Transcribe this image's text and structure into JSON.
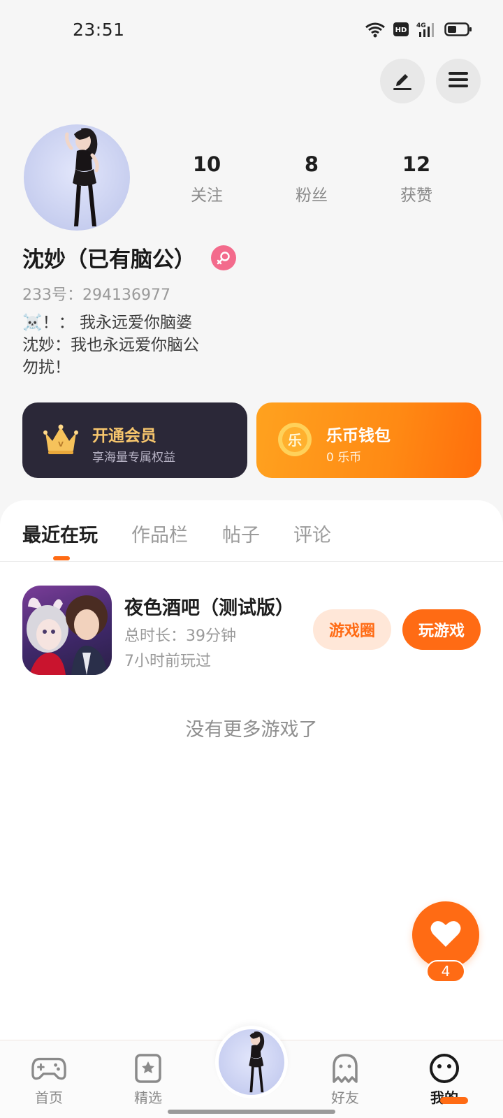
{
  "status_bar": {
    "time": "23:51",
    "network": "4G",
    "hd_label": "HD"
  },
  "profile": {
    "nickname": "沈妙（已有脑公）",
    "uid": "233号：294136977",
    "bio_lines": [
      "☠️！： 我永远爱你脑婆",
      "沈妙：我也永远爱你脑公",
      "勿扰！"
    ],
    "stats": [
      {
        "num": "10",
        "label": "关注"
      },
      {
        "num": "8",
        "label": "粉丝"
      },
      {
        "num": "12",
        "label": "获赞"
      }
    ]
  },
  "cards": {
    "vip": {
      "title": "开通会员",
      "subtitle": "享海量专属权益"
    },
    "wallet": {
      "title": "乐币钱包",
      "subtitle": "0 乐币",
      "coin_glyph": "乐"
    }
  },
  "tabs": [
    "最近在玩",
    "作品栏",
    "帖子",
    "评论"
  ],
  "games": [
    {
      "title": "夜色酒吧（测试版）",
      "duration": "总时长：39分钟",
      "last_played": "7小时前玩过",
      "circle_button": "游戏圈",
      "play_button": "玩游戏"
    }
  ],
  "empty_text": "没有更多游戏了",
  "like_count": "4",
  "bottom_nav": [
    {
      "label": "首页",
      "icon": "gamepad-icon"
    },
    {
      "label": "精选",
      "icon": "star-book-icon"
    },
    {
      "label": "好友",
      "icon": "ghost-icon"
    },
    {
      "label": "我的",
      "icon": "face-icon"
    }
  ],
  "colors": {
    "accent": "#ff6b14",
    "vip_bg": "#2b2838",
    "vip_text": "#f7c66d",
    "gender": "#f36b8c"
  }
}
